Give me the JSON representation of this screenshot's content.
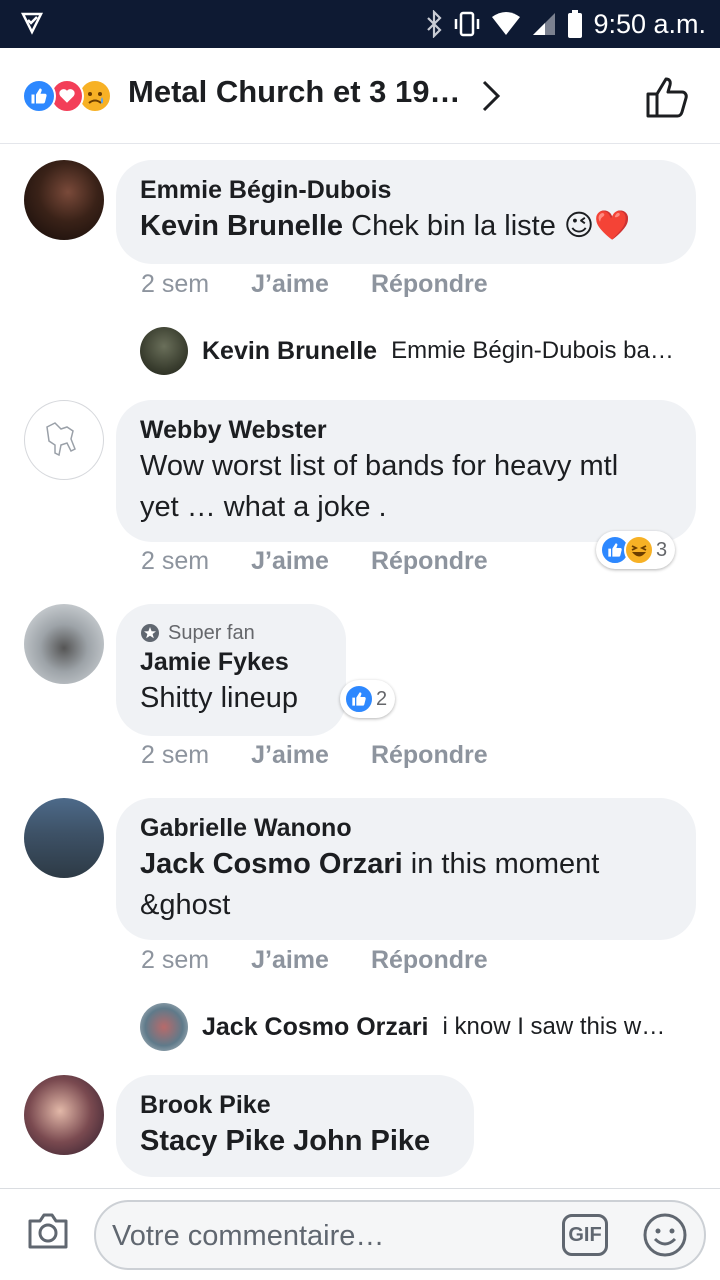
{
  "status_bar": {
    "time": "9:50 a.m."
  },
  "header": {
    "title": "Metal Church et 3 19…"
  },
  "comments": [
    {
      "author": "Emmie Bégin-Dubois",
      "mention": "Kevin Brunelle",
      "text": " Chek bin la liste 😉❤️",
      "time": "2 sem",
      "like": "J’aime",
      "reply": "Répondre"
    },
    {
      "author": "Webby Webster",
      "mention": "",
      "text": "Wow worst list of bands for heavy mtl yet … what a joke .",
      "time": "2 sem",
      "like": "J’aime",
      "reply": "Répondre",
      "reaction_count": "3"
    },
    {
      "badge": "Super fan",
      "author": "Jamie Fykes",
      "mention": "",
      "text": "Shitty lineup",
      "time": "2 sem",
      "like": "J’aime",
      "reply": "Répondre",
      "reaction_count": "2"
    },
    {
      "author": "Gabrielle Wanono",
      "mention": "Jack Cosmo Orzari",
      "text": " in this moment &ghost",
      "time": "2 sem",
      "like": "J’aime",
      "reply": "Répondre"
    },
    {
      "author": "Brook Pike",
      "mention": "Stacy Pike John Pike",
      "text": ""
    }
  ],
  "replies": [
    {
      "author": "Kevin Brunelle",
      "text": "Emmie Bégin-Dubois ba…"
    },
    {
      "author": "Jack Cosmo Orzari",
      "text": "i know I saw this w…"
    }
  ],
  "composer": {
    "placeholder": "Votre commentaire…",
    "gif": "GIF"
  },
  "colors": {
    "status_bar": "#0e1a33",
    "like_blue": "#2d88ff",
    "love_red": "#f33e58",
    "bubble": "#f0f2f5",
    "meta_gray": "#8d949e"
  },
  "icons": [
    "notification-icon",
    "bluetooth-icon",
    "vibrate-icon",
    "wifi-icon",
    "signal-icon",
    "battery-icon",
    "chevron-right-icon",
    "thumbs-up-icon",
    "camera-icon",
    "gif-icon",
    "emoji-icon",
    "star-icon"
  ]
}
